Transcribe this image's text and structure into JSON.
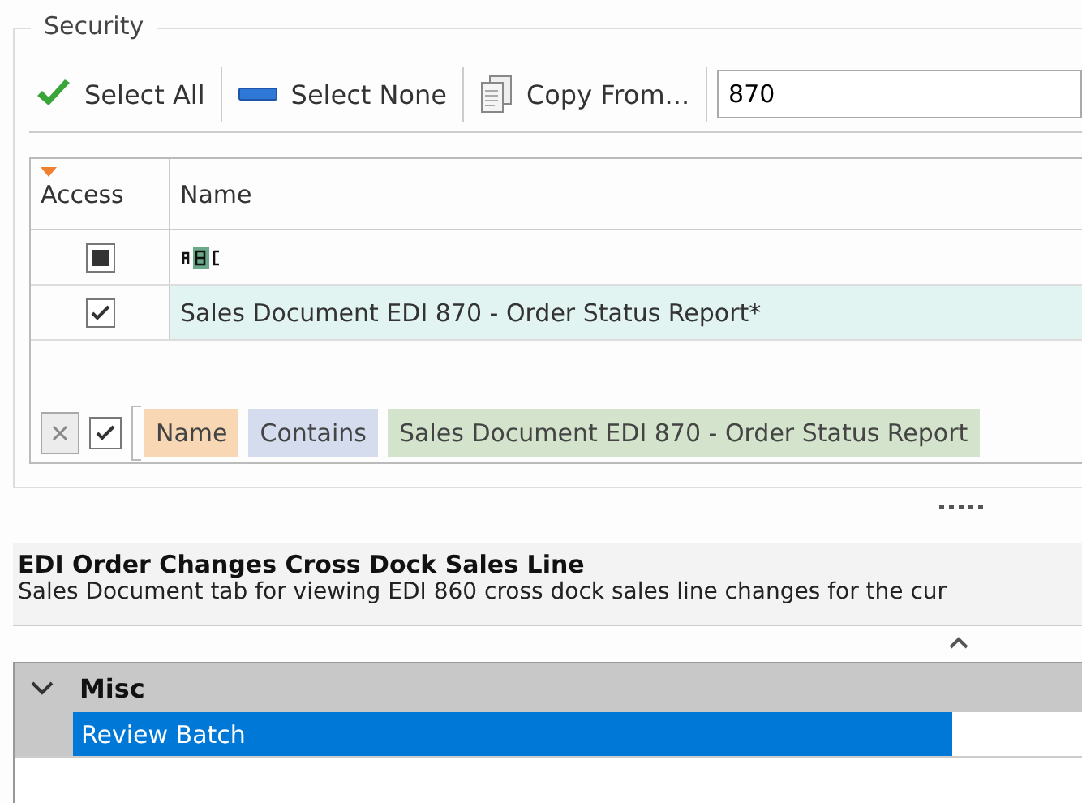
{
  "group": {
    "title": "Security"
  },
  "toolbar": {
    "buttons": [
      {
        "kind": "check",
        "label": "Select All"
      },
      {
        "kind": "bar",
        "label": "Select None"
      },
      {
        "kind": "copy",
        "label": "Copy From..."
      }
    ],
    "search": {
      "value": "870"
    }
  },
  "grid": {
    "columns": [
      "Access",
      "Name"
    ],
    "rows": [
      {
        "kind": "filter",
        "indeterminate": true,
        "selected": false
      },
      {
        "kind": "data",
        "checked": true,
        "name": "Sales Document EDI 870 - Order Status Report*",
        "selected": true
      }
    ]
  },
  "filter": {
    "enabled": true,
    "tokens": [
      {
        "text": "Name",
        "color": "#f8d8b4"
      },
      {
        "text": "Contains",
        "color": "#d4dcee"
      },
      {
        "text": "Sales Document EDI 870 - Order Status Report",
        "color": "#d4e4cc"
      }
    ]
  },
  "description": {
    "title": "EDI Order Changes Cross Dock Sales Line",
    "text": "Sales Document tab for viewing EDI 860 cross dock sales line changes for the cur"
  },
  "properties": {
    "categories": [
      {
        "label": "Misc",
        "expanded": true,
        "items": [
          {
            "label": "Review Batch",
            "selected": true
          }
        ]
      }
    ]
  }
}
